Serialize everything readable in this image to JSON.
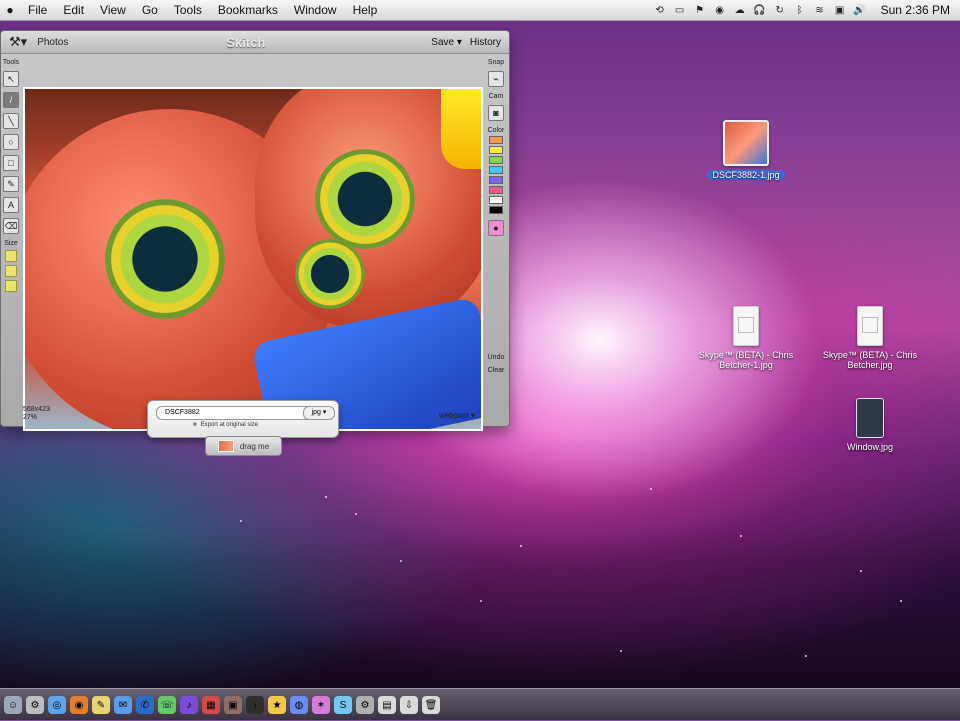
{
  "menubar": {
    "items": [
      "File",
      "Edit",
      "View",
      "Go",
      "Tools",
      "Bookmarks",
      "Window",
      "Help"
    ],
    "clock": "Sun 2:36 PM"
  },
  "skitch": {
    "toolbar": {
      "tools_label": "Photos",
      "title": "Skitch",
      "save_label": "Save ▾",
      "history_label": "History"
    },
    "left_tools": {
      "tools_label": "Tools",
      "size_label": "Size"
    },
    "right_tools": {
      "snap_label": "Snap",
      "cam_label": "Cam",
      "color_label": "Color",
      "undo_label": "Undo",
      "clear_label": "Clear"
    },
    "status": {
      "dimensions": "568x423",
      "zoom": "27%",
      "webpost": "webpost ▾"
    },
    "export": {
      "filename": "DSCF3882",
      "extension": "jpg ▾",
      "note": "Export at original size",
      "drag_label": "drag me"
    }
  },
  "desktop_icons": [
    {
      "label": "DSCF3882-1.jpg"
    },
    {
      "label": "Skype™ (BETA) - Chris Betcher-1.jpg"
    },
    {
      "label": "Skype™ (BETA) - Chris Betcher.jpg"
    },
    {
      "label": "Window.jpg"
    }
  ],
  "colors": {
    "menubar": "#e8e8e8",
    "selection": "#3a6bd6",
    "accent": "#e45a3e"
  }
}
